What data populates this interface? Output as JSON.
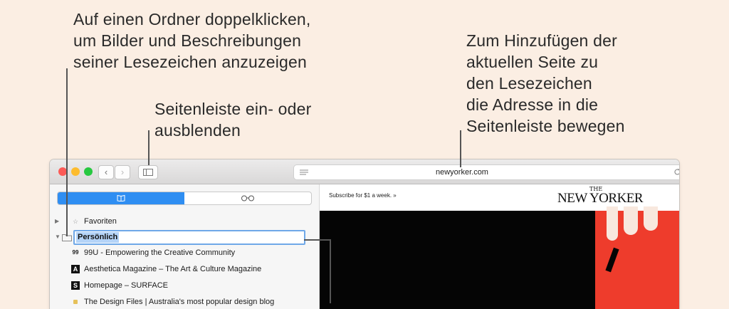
{
  "callouts": {
    "folder": "Auf einen Ordner doppelklicken,\num Bilder und Beschreibungen\nseiner Lesezeichen anzuzeigen",
    "sidebar_toggle": "Seitenleiste ein- oder\nausblenden",
    "add_page": "Zum Hinzufügen der\naktuellen Seite zu\nden Lesezeichen\ndie Adresse in die\nSeitenleiste bewegen"
  },
  "colors": {
    "background": "#fbeee3",
    "accent": "#2f8ef2",
    "close": "#fc5b57",
    "minimize": "#fdbc2e",
    "zoom": "#27c840"
  },
  "toolbar": {
    "back_icon": "chevron-left-icon",
    "forward_icon": "chevron-right-icon",
    "sidebar_icon": "sidebar-icon",
    "address_url": "newyorker.com",
    "reader_icon": "reader-lines-icon",
    "reload_icon": "reload-icon"
  },
  "sidebar": {
    "tabs": [
      {
        "icon": "book-icon",
        "selected": true
      },
      {
        "icon": "glasses-icon",
        "selected": false
      }
    ],
    "items": [
      {
        "label": "Favoriten",
        "icon": "star-folder-icon"
      },
      {
        "label": "Persönlich",
        "icon": "folder-icon",
        "editing": true
      },
      {
        "label": "99U - Empowering the Creative Community",
        "favicon": "99"
      },
      {
        "label": "Aesthetica Magazine – The Art & Culture Magazine",
        "favicon": "A"
      },
      {
        "label": "Homepage – SURFACE",
        "favicon": "S"
      },
      {
        "label": "The Design Files | Australia's most popular design blog",
        "favicon": ""
      }
    ]
  },
  "page": {
    "subscribe_text": "Subscribe for $1 a week. »",
    "logo_the": "THE",
    "logo_name": "NEW YORKER"
  }
}
